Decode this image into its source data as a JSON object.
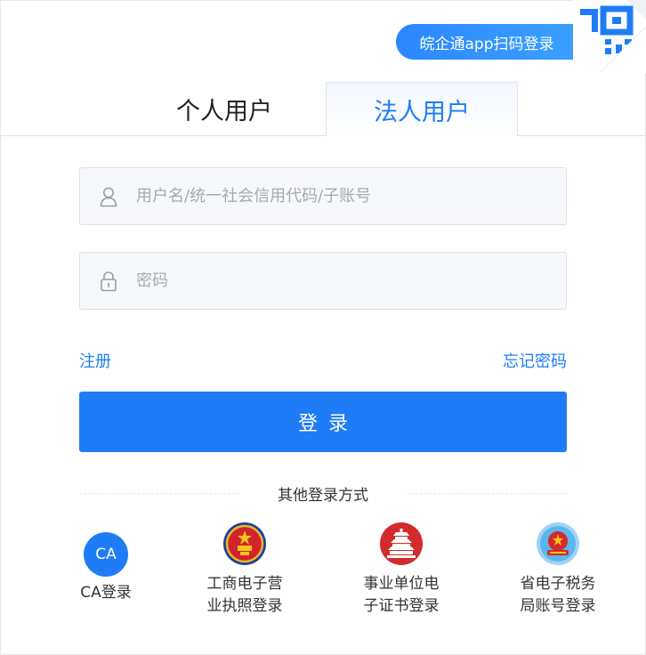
{
  "header": {
    "app_scan_label": "皖企通app扫码登录"
  },
  "tabs": [
    {
      "label": "个人用户",
      "active": false
    },
    {
      "label": "法人用户",
      "active": true
    }
  ],
  "form": {
    "username_placeholder": "用户名/统一社会信用代码/子账号",
    "username_value": "",
    "password_placeholder": "密码",
    "password_value": "",
    "register_label": "注册",
    "forgot_label": "忘记密码",
    "login_label": "登录"
  },
  "other_login": {
    "heading": "其他登录方式",
    "options": [
      {
        "label": "CA登录",
        "icon": "ca-icon",
        "badge_text": "CA"
      },
      {
        "label": "工商电子营\n业执照登录",
        "icon": "national-emblem-icon"
      },
      {
        "label": "事业单位电\n子证书登录",
        "icon": "temple-of-heaven-icon"
      },
      {
        "label": "省电子税务\n局账号登录",
        "icon": "tax-emblem-icon"
      }
    ]
  },
  "colors": {
    "accent": "#1e7cf6",
    "field_bg": "#f7f8fc",
    "field_border": "#dde0e8",
    "text": "#333333"
  }
}
